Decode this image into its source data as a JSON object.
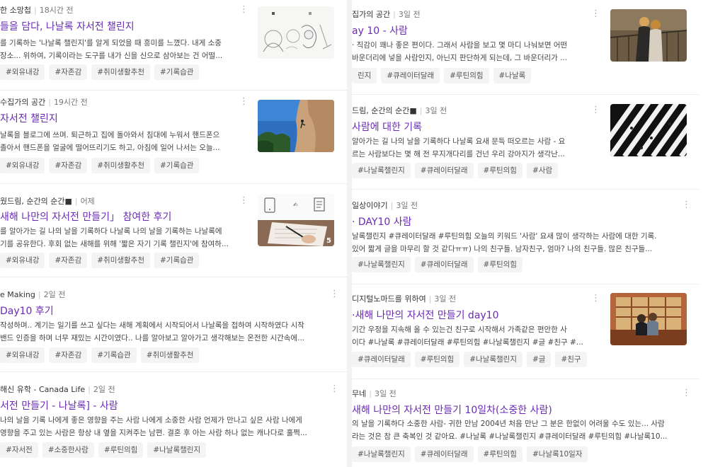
{
  "left": [
    {
      "author": "한 소망첩",
      "time": "18시간 전",
      "title": "들을 담다, 나날록 자서전 챌린지",
      "desc": [
        "를 기록하는 '나날록 챌린지'를 알게 되었을 때 흥미를 느꼈다. 내게 소중",
        "장소... 위하여, 기록이라는 도구를 내가 신을 신으로 삼아보는 건 어떨..."
      ],
      "tags": [
        "#외유내강",
        "#자존감",
        "#취미생활추천",
        "#기록습관"
      ]
    },
    {
      "author": "수집가의 공간",
      "time": "19시간 전",
      "title": "자서전 챌린지",
      "desc": [
        "날록을 블로그에 쓰며. 퇴근하고 집에 돌아와서 침대에 누워서 핸드폰으",
        "졸아서 핸드폰을 얼굴에 떨어뜨리기도 하고, 아침에 일어 나서는 오늘..."
      ],
      "tags": [
        "#외유내강",
        "#자존감",
        "#취미생활추천",
        "#기록습관"
      ]
    },
    {
      "author": "웠드림, 순간의 순간■",
      "time": "어제",
      "title": "새해 나만의 자서전 만들기」 참여한 후기",
      "desc": [
        "를 알아가는 길 나의 날을 기록하다 나날록 나의 날을 기록하는 나날록에",
        "기를 공유한다. 후회 없는 새해를 위해 '짧은 자기 기록 챌린지'에 참여하..."
      ],
      "tags": [
        "#외유내강",
        "#자존감",
        "#취미생활추천",
        "#기록습관"
      ],
      "thumb_count": "5"
    },
    {
      "author": "e Making",
      "time": "2일 전",
      "title": "Day10 후기",
      "desc": [
        "작성하며.. 계기는 일기를 쓰고 싶다는 새해 계획에서 시작되어서 나날록을 접하여 시작하였다 시작",
        "밴드 인증을 하며 너무 재밌는 시간이였다.. 나를 알아보고 알아가고 생각해보는 온전한 시간속에..."
      ],
      "tags": [
        "#외유내강",
        "#자존감",
        "#기록습관",
        "#취미생활추천"
      ]
    },
    {
      "author": "해신 유학 - Canada Life",
      "time": "2일 전",
      "title": "서전 만들기 - 나날록] - 사람",
      "desc": [
        "나의 날을 기록 나에게 좋은 영향을 주는 사람 나에게 소중한 사람 언제가 만나고 싶은 사람 나에게",
        "영향을 주고 있는 사람은 항상 내 옆을 지켜주는 남편. 결혼 후 아는 사람 하나 없는 캐나다로 훌쩍..."
      ],
      "tags": [
        "#자서전",
        "#소중한사람",
        "#루틴의힘",
        "#나날록챌린지"
      ]
    }
  ],
  "right": [
    {
      "author": "집가의 공간",
      "time": "3일 전",
      "title": "ay 10 - 사람",
      "desc": [
        "· 직감이 꽤나 좋은 편이다. 그래서 사람을 보고 몇 마디 나눠보면 어떤",
        "바운더리에 넣을 사람인지, 아닌지 판단하게 되는데, 그 바운더리가 ..."
      ],
      "tags": [
        "린지",
        "#큐레이터달래",
        "#루틴의힘",
        "#나날록"
      ]
    },
    {
      "author": "드림, 순간의 순간■",
      "time": "3일 전",
      "title": "사람에 대한 기록",
      "desc": [
        "알아가는 길 나의 날을 기록하다 나날록 요새 문득 떠오르는 사람 - 요",
        "르는 사람보다는 몇 해 전 무지개다리를 건넌 우리 강아지가 생각난..."
      ],
      "tags": [
        "#나날록챌린지",
        "#큐레이터달래",
        "#루틴의힘",
        "#사람"
      ]
    },
    {
      "author": "일상이야기",
      "time": "3일 전",
      "title": "· DAY10 사람",
      "desc": [
        "날록챌린지 #큐레이터달래 #루틴의힘 오늘의 키워드 '사람' 요새 많이 생각하는 사람에 대한 기록.",
        "있어 짧게 글을 마무리 할 것 같다ㅠㅠ) 나의 친구들. 남자친구, 엄마? 나의 친구들. 많은 친구들..."
      ],
      "tags": [
        "#나날록챌린지",
        "#큐레이터달래",
        "#루틴의힘"
      ]
    },
    {
      "author": "디지털노마드를 위하여",
      "time": "3일 전",
      "title": "·새해 나만의 자서전 만들기 day10",
      "desc": [
        "기간 우정을 지속해 올 수 있는건 친구로 시작해서 가족같은 편안한 사",
        "이다 #나날록 #큐레이터달래 #루틴의힘 #나날록챌린지 #글 #친구 #..."
      ],
      "tags": [
        "#큐레이터달래",
        "#루틴의힘",
        "#나날록챌린지",
        "#글",
        "#친구"
      ]
    },
    {
      "author": "무네",
      "time": "3일 전",
      "title": "새해 나만의 자서전 만들기 10일차(소중한 사람)",
      "desc": [
        "의 날을 기록하다 소중한 사람- 귀한 만남 2004년 처음 만난 그 분은 한없이 어려울 수도 있는... 사람",
        "라는 것은 참 큰 축복인 것 같아요. #나날록 #나날록챌린지 #큐레이터달래 #루틴의힘 #나날록10..."
      ],
      "tags": [
        "#나날록챌린지",
        "#큐레이터달래",
        "#루틴의힘",
        "#나날록10일자"
      ]
    }
  ],
  "icons": {
    "more": "⋮"
  }
}
